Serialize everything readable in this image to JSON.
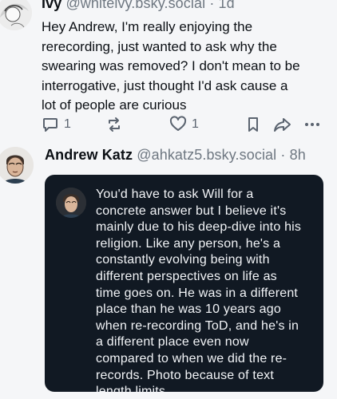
{
  "post1": {
    "name": "Ivy",
    "handle": "@whiteivy.bsky.social",
    "sep": "·",
    "age": "1d",
    "text_lines": [
      "Hey Andrew, I'm really enjoying the",
      "rerecording, just wanted to ask why the",
      "swearing was removed? I don't mean to be",
      "interrogative, just thought I'd ask cause a",
      "lot of people are curious"
    ],
    "actions": {
      "reply_count": "1",
      "like_count": "1"
    }
  },
  "post2": {
    "name": "Andrew Katz",
    "handle": "@ahkatz5.bsky.social",
    "sep": "·",
    "age": "8h",
    "image_text_lines": [
      "You'd have to ask Will for a",
      "concrete answer but I believe it's",
      "mainly due to his deep-dive into his",
      "religion. Like any person, he's a",
      "constantly evolving being with",
      "different perspectives on life as",
      "time goes on. He was in a different",
      "place than he was 10 years ago",
      "when re-recording ToD, and he's in",
      "a different place even now",
      "compared to when we did the re-",
      "records. Photo because of text",
      "length limits."
    ]
  },
  "icons": [
    "reply-icon",
    "repost-icon",
    "like-icon",
    "bookmark-icon",
    "share-icon",
    "more-icon"
  ],
  "colors": {
    "background": "#f5f6f8",
    "muted": "#6e7781",
    "card": "#111923",
    "card_text": "#f2f4f7"
  }
}
